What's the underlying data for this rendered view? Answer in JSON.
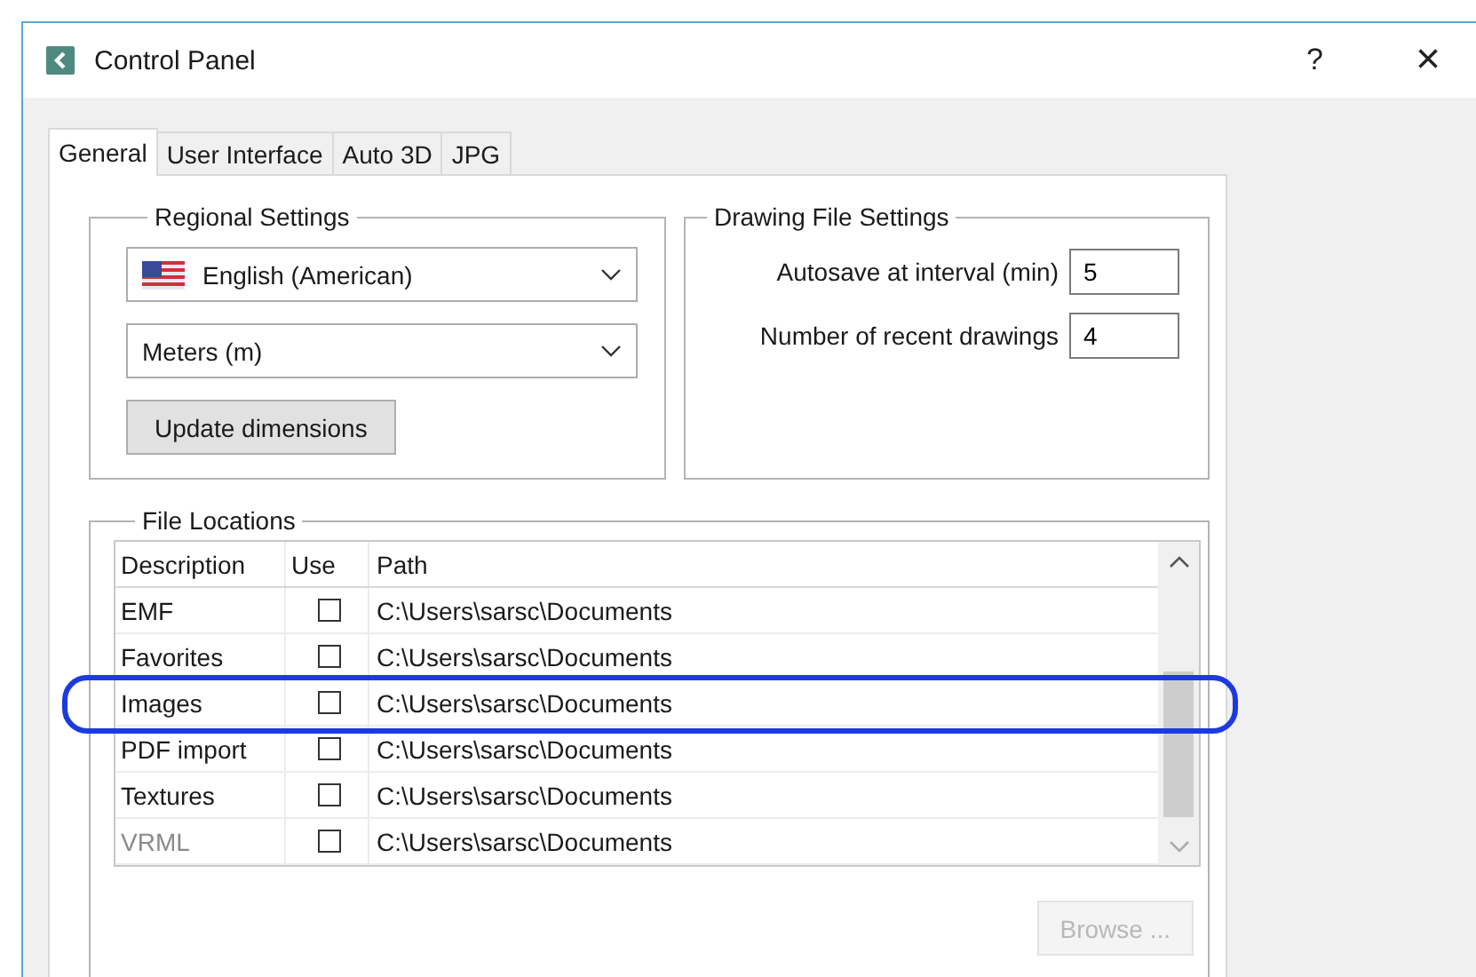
{
  "window": {
    "title": "Control Panel",
    "help": "?",
    "close": "×"
  },
  "tabs": [
    {
      "label": "General",
      "selected": true
    },
    {
      "label": "User Interface",
      "selected": false
    },
    {
      "label": "Auto 3D",
      "selected": false
    },
    {
      "label": "JPG",
      "selected": false
    }
  ],
  "regional_settings": {
    "title": "Regional Settings",
    "language": "English (American)",
    "units": "Meters (m)",
    "update_button": "Update dimensions"
  },
  "drawing_file_settings": {
    "title": "Drawing File Settings",
    "fields": [
      {
        "label": "Autosave at interval (min)",
        "value": "5"
      },
      {
        "label": "Number of recent drawings",
        "value": "4"
      }
    ]
  },
  "file_locations": {
    "title": "File Locations",
    "columns": [
      "Description",
      "Use",
      "Path"
    ],
    "rows": [
      {
        "description": "EMF",
        "checked": false,
        "path": "C:\\Users\\sarsc\\Documents",
        "disabled": false,
        "highlighted": false
      },
      {
        "description": "Favorites",
        "checked": false,
        "path": "C:\\Users\\sarsc\\Documents",
        "disabled": false,
        "highlighted": false
      },
      {
        "description": "Images",
        "checked": false,
        "path": "C:\\Users\\sarsc\\Documents",
        "disabled": false,
        "highlighted": true
      },
      {
        "description": "PDF import",
        "checked": false,
        "path": "C:\\Users\\sarsc\\Documents",
        "disabled": false,
        "highlighted": false
      },
      {
        "description": "Textures",
        "checked": false,
        "path": "C:\\Users\\sarsc\\Documents",
        "disabled": false,
        "highlighted": false
      },
      {
        "description": "VRML",
        "checked": false,
        "path": "C:\\Users\\sarsc\\Documents",
        "disabled": true,
        "highlighted": false
      }
    ],
    "browse_button": {
      "label": "Browse ...",
      "disabled": true
    }
  }
}
